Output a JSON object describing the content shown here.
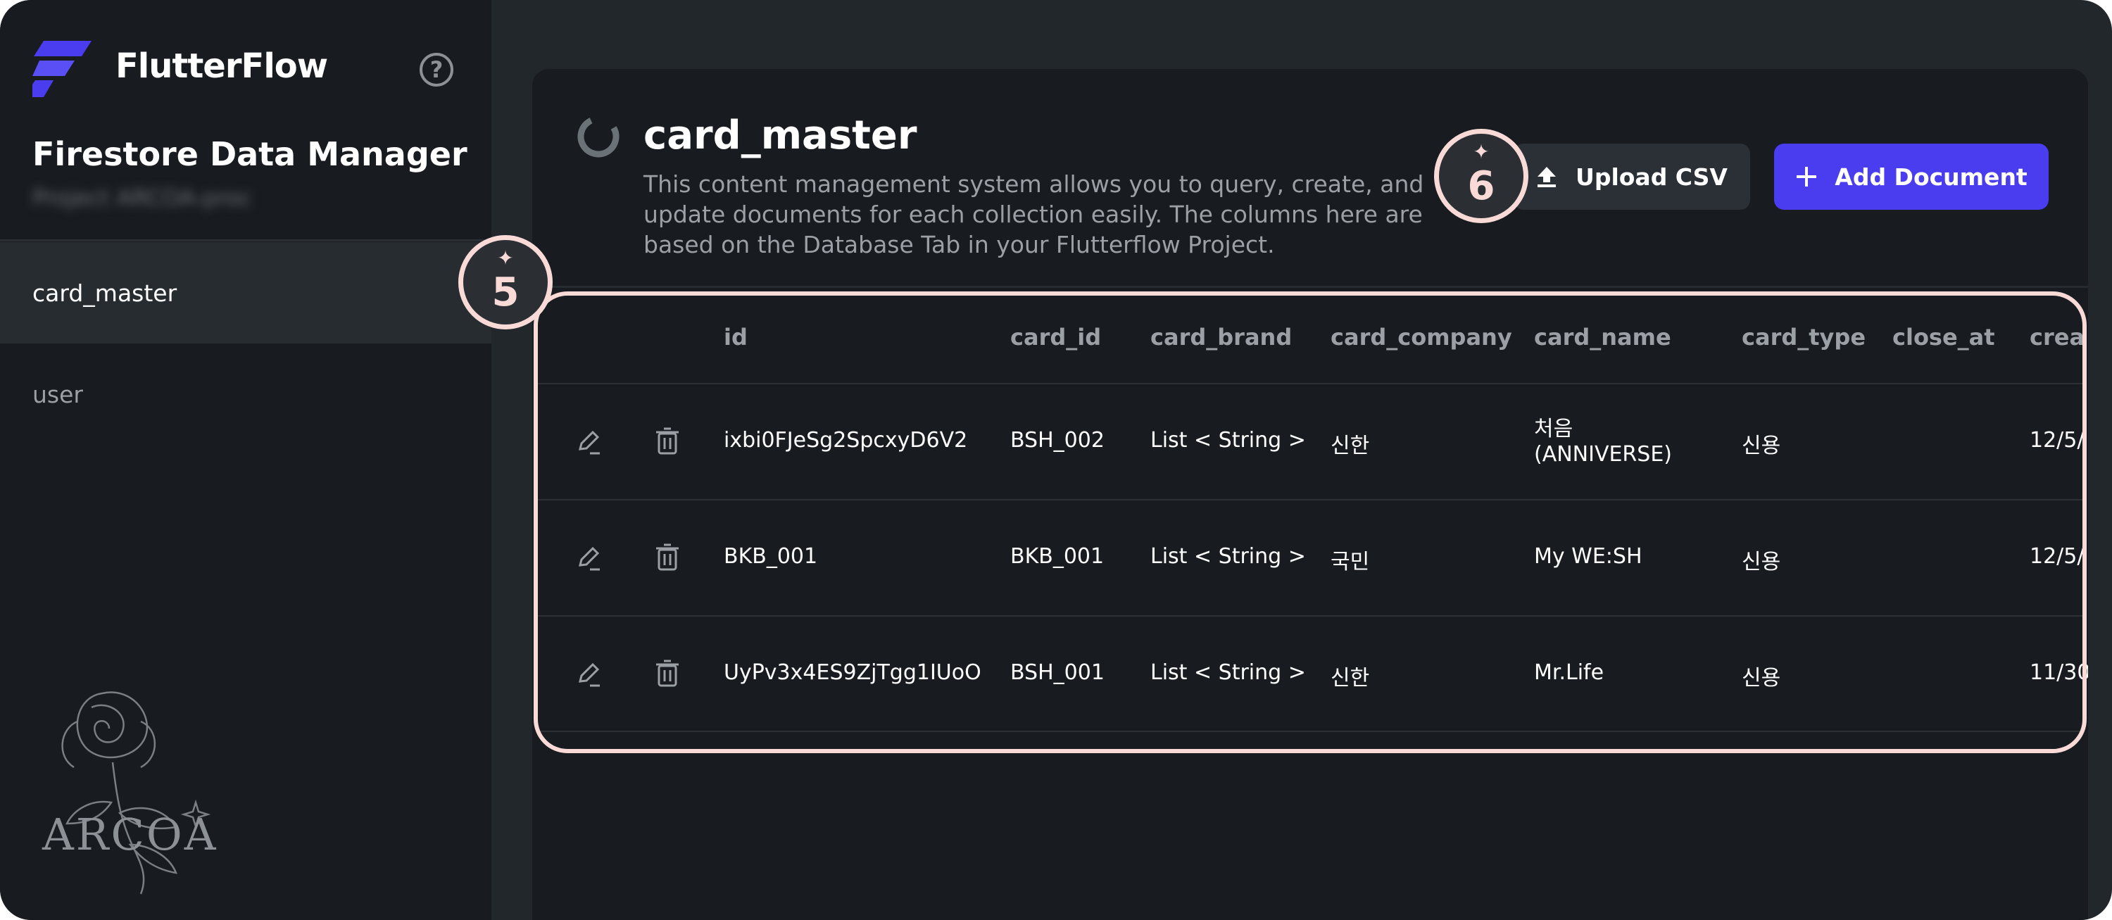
{
  "brand": {
    "name": "FlutterFlow"
  },
  "sidebar": {
    "title": "Firestore Data Manager",
    "project": "Project ARCOA-proc",
    "items": [
      {
        "label": "card_master",
        "active": true
      },
      {
        "label": "user",
        "active": false
      }
    ],
    "watermark_text": "ARCOA"
  },
  "main": {
    "collection_title": "card_master",
    "description": "This content management system allows you to query, create, and update documents for each collection easily. The columns here are based on the Database Tab in your Flutterflow Project.",
    "upload_label": "Upload CSV",
    "add_label": "Add Document"
  },
  "table": {
    "columns": [
      "id",
      "card_id",
      "card_brand",
      "card_company",
      "card_name",
      "card_type",
      "close_at",
      "crea"
    ],
    "rows": [
      {
        "id": "ixbi0FJeSg2SpcxyD6V2",
        "card_id": "BSH_002",
        "card_brand": "List < String >",
        "card_company": "신한",
        "card_name_line1": "처음",
        "card_name_line2": "(ANNIVERSE)",
        "card_type": "신용",
        "close_at": "",
        "created": "12/5/"
      },
      {
        "id": "BKB_001",
        "card_id": "BKB_001",
        "card_brand": "List < String >",
        "card_company": "국민",
        "card_name_line1": "My WE:SH",
        "card_name_line2": "",
        "card_type": "신용",
        "close_at": "",
        "created": "12/5/"
      },
      {
        "id": "UyPv3x4ES9ZjTgg1IUoO",
        "card_id": "BSH_001",
        "card_brand": "List < String >",
        "card_company": "신한",
        "card_name_line1": "Mr.Life",
        "card_name_line2": "",
        "card_type": "신용",
        "close_at": "",
        "created": "11/30"
      }
    ]
  },
  "tutorial": {
    "badge_table": "5",
    "badge_upload": "6",
    "highlight_color": "#f9dad7"
  },
  "colors": {
    "background": "#22272b",
    "sidebar": "#181b1f",
    "accent": "#4a3df0"
  }
}
